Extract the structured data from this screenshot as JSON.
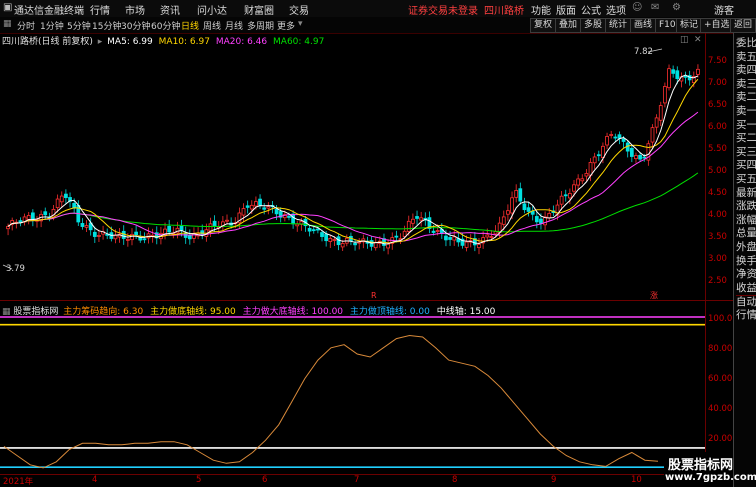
{
  "menubar": {
    "app_title": "通达信金融终端",
    "items": [
      "行情",
      "市场",
      "资讯",
      "问小达",
      "财富圈",
      "交易"
    ],
    "center_notice": "证券交易未登录",
    "stock_name_top": "四川路桥",
    "right_items": [
      "功能",
      "版面",
      "公式",
      "选项"
    ],
    "user": "游客"
  },
  "toolbar": {
    "periods": [
      "分时",
      "1分钟",
      "5分钟",
      "15分钟",
      "30分钟",
      "60分钟",
      "日线",
      "周线",
      "月线",
      "多周期",
      "更多"
    ],
    "active_period": "日线",
    "right_buttons": [
      "复权",
      "叠加",
      "多股",
      "统计",
      "画线",
      "F10",
      "标记",
      "+自选",
      "返回"
    ]
  },
  "main_chart": {
    "header_name": "四川路桥(日线 前复权)",
    "ma_labels": [
      {
        "text": "MA5: 6.99",
        "color": "#ffffff"
      },
      {
        "text": "MA10: 6.97",
        "color": "#ffd700"
      },
      {
        "text": "MA20: 6.46",
        "color": "#ff40ff"
      },
      {
        "text": "MA60: 4.97",
        "color": "#00e000"
      }
    ],
    "high_label": "7.82",
    "low_label": "3.79",
    "y_ticks": [
      "7.50",
      "7.00",
      "6.50",
      "6.00",
      "5.50",
      "5.00",
      "4.50",
      "4.00",
      "3.50",
      "3.00",
      "2.50"
    ],
    "event_markers": [
      "R",
      "涨"
    ]
  },
  "indicator": {
    "name": "股票指标网",
    "lines": [
      {
        "text": "主力筹码趋向: 6.30",
        "color": "#ff8c00"
      },
      {
        "text": "主力做底轴线: 95.00",
        "color": "#ffd700"
      },
      {
        "text": "主力做大底轴线: 100.00",
        "color": "#ff40ff"
      },
      {
        "text": "主力做顶轴线: 0.00",
        "color": "#20b0ff"
      },
      {
        "text": "中线轴: 15.00",
        "color": "#ffffff"
      }
    ],
    "y_ticks": [
      "100.0",
      "80.00",
      "60.00",
      "40.00",
      "20.00"
    ]
  },
  "x_axis": {
    "labels": [
      "2021年",
      "4",
      "5",
      "6",
      "7",
      "8",
      "9",
      "10"
    ]
  },
  "sidebar": {
    "items": [
      "委比",
      "卖五",
      "卖四",
      "卖三",
      "卖二",
      "卖一",
      "买一",
      "买二",
      "买三",
      "买四",
      "买五",
      "最新",
      "涨跌",
      "涨幅",
      "总量",
      "外盘",
      "换手",
      "净资",
      "收益",
      "自动",
      "行情"
    ]
  },
  "watermark": {
    "line1": "股票指标网",
    "line2": "www.7gpzb.com"
  },
  "colors": {
    "up": "#ff3030",
    "down": "#00e0e0",
    "ma5": "#ffffff",
    "ma10": "#ffd700",
    "ma20": "#ff40ff",
    "ma60": "#00e000",
    "osc": "#d98a3a"
  },
  "chart_data": [
    {
      "type": "candlestick",
      "title": "四川路桥(日线 前复权)",
      "ylim": [
        2.5,
        7.8
      ],
      "y_ticks": [
        7.5,
        7.0,
        6.5,
        6.0,
        5.5,
        5.0,
        4.5,
        4.0,
        3.5,
        3.0,
        2.5
      ],
      "close_approx": [
        3.79,
        3.9,
        4.0,
        4.1,
        4.5,
        3.9,
        3.7,
        3.6,
        3.5,
        3.6,
        3.6,
        3.6,
        3.7,
        3.6,
        3.7,
        3.8,
        3.9,
        4.3,
        4.2,
        4.1,
        4.0,
        3.8,
        3.6,
        3.5,
        3.5,
        3.4,
        3.4,
        3.5,
        3.6,
        4.0,
        3.8,
        3.6,
        3.4,
        3.4,
        3.6,
        3.8,
        4.5,
        4.1,
        3.9,
        4.2,
        4.6,
        5.0,
        5.4,
        5.8,
        5.5,
        5.2,
        6.0,
        7.2,
        7.0,
        7.1
      ],
      "series": [
        {
          "name": "MA5",
          "last": 6.99
        },
        {
          "name": "MA10",
          "last": 6.97
        },
        {
          "name": "MA20",
          "last": 6.46
        },
        {
          "name": "MA60",
          "last": 4.97
        }
      ],
      "annotations": [
        {
          "label": "7.82"
        },
        {
          "label": "3.79"
        }
      ]
    },
    {
      "type": "line",
      "title": "股票指标网",
      "ylim": [
        0,
        100
      ],
      "y_ticks": [
        100,
        80,
        60,
        40,
        20
      ],
      "series": [
        {
          "name": "主力筹码趋向",
          "values": [
            16,
            10,
            4,
            2,
            6,
            14,
            18,
            18,
            17,
            17,
            18,
            18,
            19,
            19,
            17,
            12,
            7,
            5,
            6,
            12,
            20,
            30,
            45,
            60,
            72,
            80,
            82,
            76,
            74,
            80,
            86,
            88,
            87,
            80,
            72,
            70,
            68,
            62,
            54,
            44,
            34,
            24,
            16,
            10,
            6,
            4,
            3,
            8,
            12,
            7,
            6.3
          ]
        },
        {
          "name": "主力做底轴线",
          "values": [
            95
          ]
        },
        {
          "name": "主力做大底轴线",
          "values": [
            100
          ]
        },
        {
          "name": "主力做顶轴线",
          "values": [
            0
          ]
        },
        {
          "name": "中线轴",
          "values": [
            15
          ]
        }
      ]
    }
  ]
}
